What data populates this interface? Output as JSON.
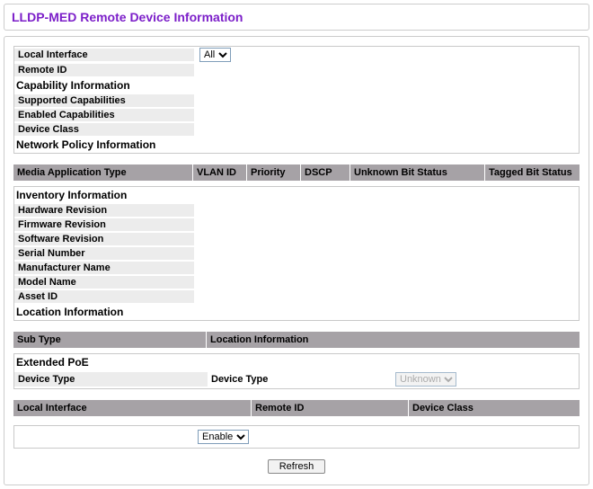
{
  "page": {
    "title": "LLDP-MED Remote Device Information"
  },
  "top": {
    "local_interface": "Local Interface",
    "remote_id": "Remote ID",
    "capability_info": "Capability Information",
    "supported_caps": "Supported Capabilities",
    "enabled_caps": "Enabled Capabilities",
    "device_class": "Device Class",
    "network_policy": "Network Policy Information",
    "all_option": "All"
  },
  "media_header": {
    "media_app_type": "Media Application Type",
    "vlan_id": "VLAN ID",
    "priority": "Priority",
    "dscp": "DSCP",
    "unknown_bit": "Unknown Bit Status",
    "tagged_bit": "Tagged Bit Status"
  },
  "inventory": {
    "heading": "Inventory Information",
    "hardware_rev": "Hardware Revision",
    "firmware_rev": "Firmware Revision",
    "software_rev": "Software Revision",
    "serial_number": "Serial Number",
    "manufacturer_name": "Manufacturer Name",
    "model_name": "Model Name",
    "asset_id": "Asset ID",
    "location_info": "Location Information"
  },
  "loc_header": {
    "sub_type": "Sub Type",
    "location_info": "Location Information"
  },
  "extended_poe": {
    "heading": "Extended PoE",
    "device_type1": "Device Type",
    "device_type2": "Device Type",
    "device_type_value": "Unknown"
  },
  "bottom_header": {
    "local_interface": "Local Interface",
    "remote_id": "Remote ID",
    "device_class": "Device Class"
  },
  "enable_select": {
    "value": "Enable"
  },
  "buttons": {
    "refresh": "Refresh"
  }
}
